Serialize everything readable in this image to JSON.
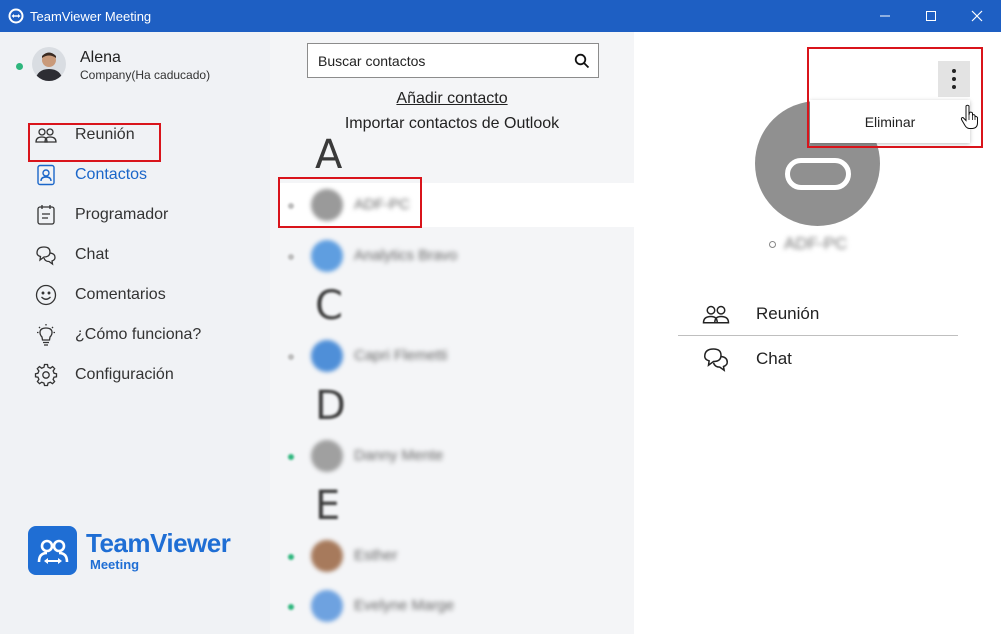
{
  "window": {
    "title": "TeamViewer Meeting",
    "controls": [
      "minimize-icon",
      "maximize-icon",
      "close-icon"
    ]
  },
  "sidebar": {
    "user": {
      "name": "Alena",
      "company": "Company(Ha caducado)",
      "status": "online"
    },
    "items": [
      {
        "label": "Reunión",
        "icon": "people-icon",
        "active": false
      },
      {
        "label": "Contactos",
        "icon": "contact-card-icon",
        "active": true
      },
      {
        "label": "Programador",
        "icon": "calendar-icon",
        "active": false
      },
      {
        "label": "Chat",
        "icon": "chat-bubbles-icon",
        "active": false
      },
      {
        "label": "Comentarios",
        "icon": "smiley-icon",
        "active": false
      },
      {
        "label": "¿Cómo funciona?",
        "icon": "lightbulb-icon",
        "active": false
      },
      {
        "label": "Configuración",
        "icon": "gear-icon",
        "active": false
      }
    ],
    "logo": {
      "main": "TeamViewer",
      "sub": "Meeting"
    }
  },
  "contacts": {
    "search_placeholder": "Buscar contactos",
    "add_contact": "Añadir contacto",
    "import_contacts": "Importar contactos de Outlook",
    "groups": [
      {
        "letter": "A",
        "contacts": [
          {
            "name": "ADF-PC",
            "status": "offline",
            "selected": true
          },
          {
            "name": "Analytics Bravo",
            "status": "offline",
            "selected": false
          }
        ]
      },
      {
        "letter": "C",
        "contacts": [
          {
            "name": "Capri Flemetti",
            "status": "offline",
            "selected": false
          }
        ]
      },
      {
        "letter": "D",
        "contacts": [
          {
            "name": "Danny Mente",
            "status": "online",
            "selected": false
          }
        ]
      },
      {
        "letter": "E",
        "contacts": [
          {
            "name": "Esther",
            "status": "online",
            "selected": false
          },
          {
            "name": "Evelyne Marge",
            "status": "online",
            "selected": false
          }
        ]
      }
    ]
  },
  "detail": {
    "name": "ADF-PC",
    "status": "offline",
    "menu_item": "Eliminar",
    "actions": [
      {
        "label": "Reunión",
        "icon": "people-icon"
      },
      {
        "label": "Chat",
        "icon": "chat-bubbles-icon"
      }
    ]
  },
  "colors": {
    "titlebar": "#1e5fc3",
    "accent": "#1a66c9",
    "highlight": "#d9141b",
    "online": "#2eb67d"
  }
}
